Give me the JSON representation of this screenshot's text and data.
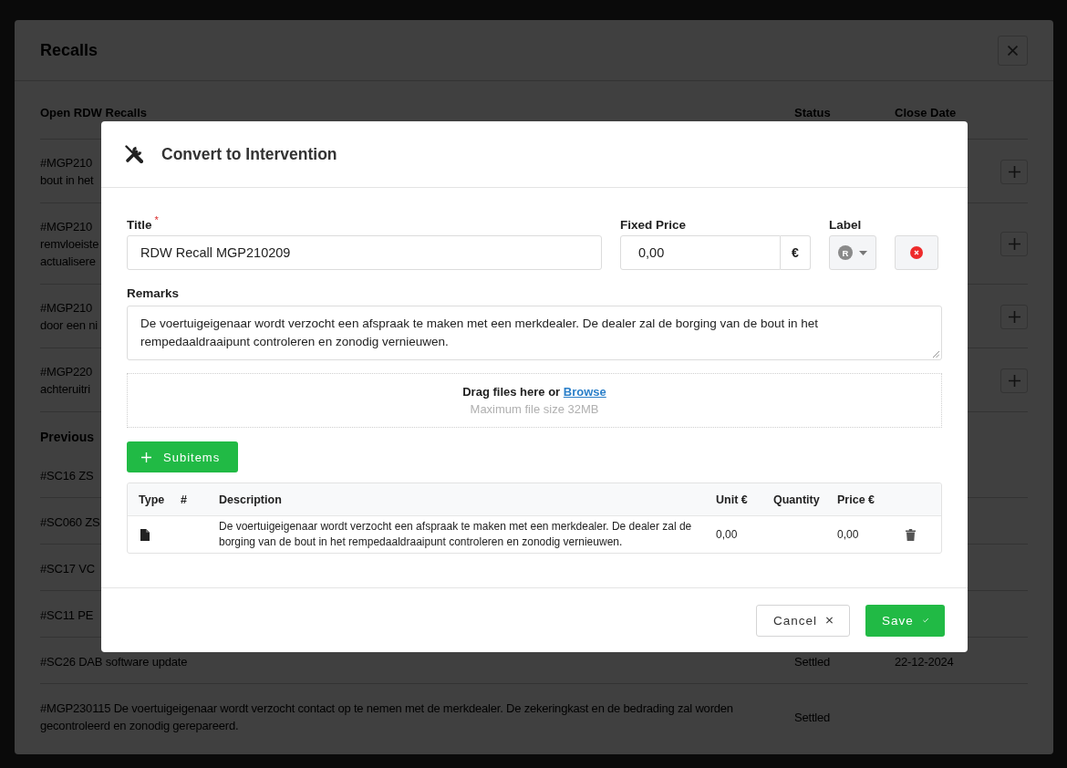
{
  "background_dialog": {
    "title": "Recalls",
    "open_recalls": {
      "heading": "Open RDW Recalls",
      "status_heading": "Status",
      "close_date_heading": "Close Date",
      "rows": [
        {
          "lines": [
            "#MGP210",
            "bout in het"
          ]
        },
        {
          "lines": [
            "#MGP210",
            "remvloeiste",
            "actualisere"
          ]
        },
        {
          "lines": [
            "#MGP210",
            "door een ni"
          ]
        },
        {
          "lines": [
            "#MGP220",
            "achteruitri"
          ]
        }
      ]
    },
    "previous_recalls": {
      "heading": "Previous",
      "rows": [
        {
          "text": "#SC16 ZS"
        },
        {
          "text": "#SC060 ZS"
        },
        {
          "text": "#SC17 VC"
        },
        {
          "text": "#SC11 PE"
        },
        {
          "text": "#SC26 DAB software update",
          "status": "Settled",
          "close_date": "22-12-2024"
        },
        {
          "text": "#MGP230115 De voertuigeigenaar wordt verzocht contact op te nemen met de merkdealer. De zekeringkast en de bedrading zal worden gecontroleerd en zonodig gerepareerd.",
          "status": "Settled"
        }
      ]
    }
  },
  "dialog": {
    "title": "Convert to Intervention",
    "title_field": {
      "label": "Title",
      "required_mark": "*",
      "value": "RDW Recall MGP210209"
    },
    "fixed_price": {
      "label": "Fixed Price",
      "value": "0,00",
      "addon": "€"
    },
    "label_field": {
      "label": "Label",
      "badge": "R"
    },
    "remarks": {
      "label": "Remarks",
      "value": "De voertuigeigenaar wordt verzocht een afspraak te maken met een merkdealer. De dealer zal de borging van de bout in het rempedaaldraaipunt controleren en zonodig vernieuwen."
    },
    "dropzone": {
      "prompt": "Drag files here or",
      "link": "Browse",
      "hint": "Maximum file size 32MB"
    },
    "add_button": "Subitems",
    "subitems": {
      "columns": [
        "Type",
        "#",
        "Description",
        "Unit €",
        "Quantity",
        "Price €"
      ],
      "rows": [
        {
          "kind": "document",
          "description": "De voertuigeigenaar wordt verzocht een afspraak te maken met een merkdealer. De dealer zal de borging van de bout in het rempedaaldraaipunt controleren en zonodig vernieuwen.",
          "unit_price": "0,00",
          "price": "0,00"
        }
      ]
    },
    "buttons": [
      {
        "label": "Cancel",
        "kind": "secondary"
      },
      {
        "label": "Save",
        "kind": "primary"
      }
    ]
  }
}
